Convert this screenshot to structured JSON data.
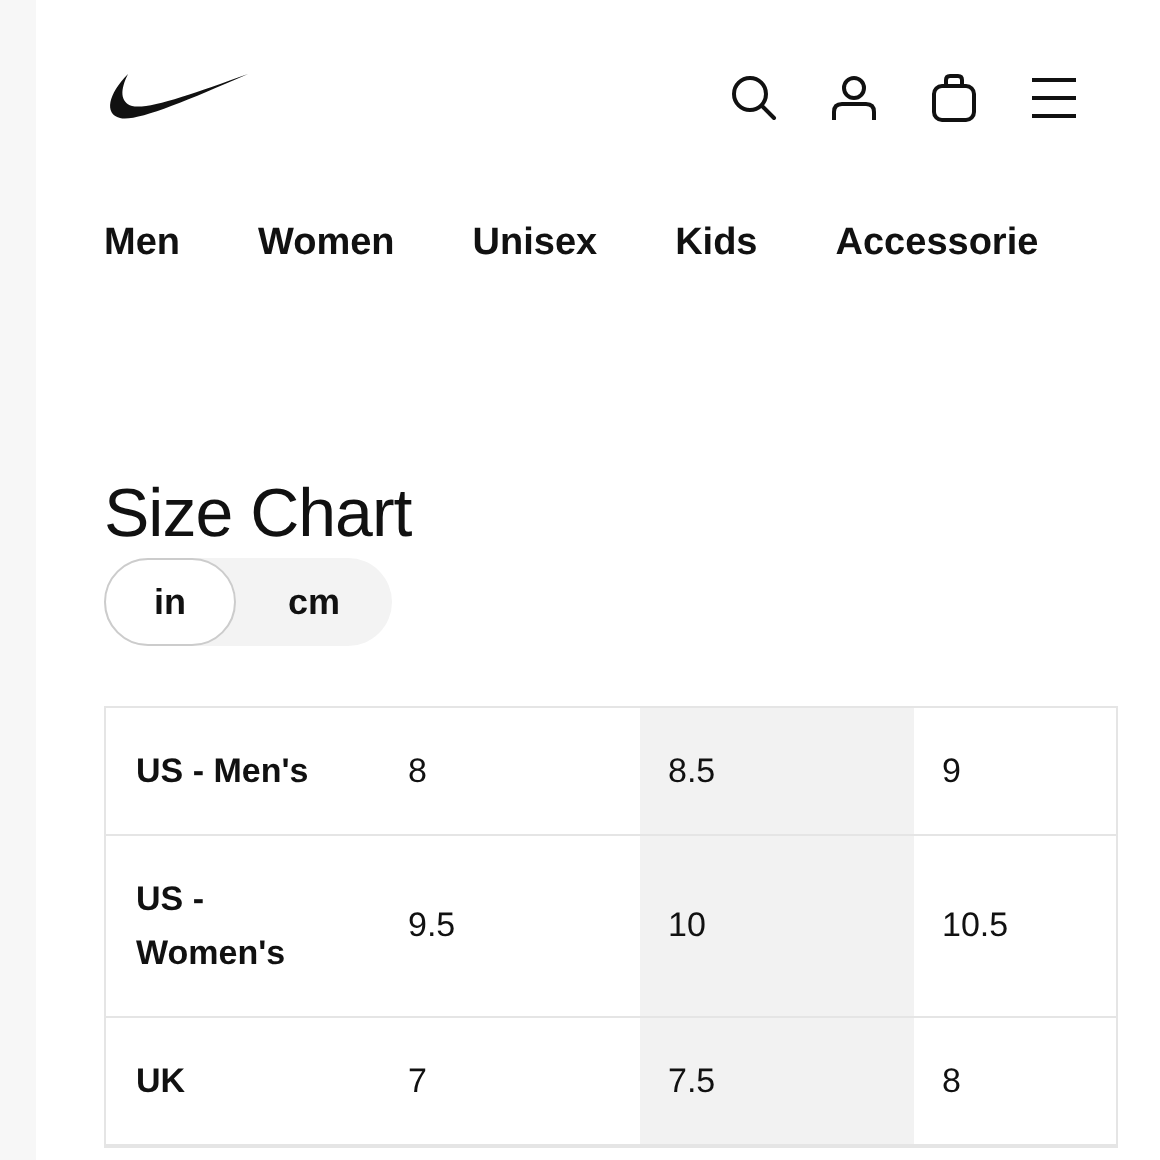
{
  "nav": [
    {
      "label": "Men"
    },
    {
      "label": "Women"
    },
    {
      "label": "Unisex"
    },
    {
      "label": "Kids"
    },
    {
      "label": "Accessorie"
    }
  ],
  "title": "Size Chart",
  "units": [
    {
      "label": "in",
      "selected": true
    },
    {
      "label": "cm",
      "selected": false
    }
  ],
  "table": {
    "rows": [
      {
        "label": "US - Men's",
        "cells": [
          {
            "text": "8",
            "shaded": false
          },
          {
            "text": "8.5",
            "shaded": true
          },
          {
            "text": "9",
            "shaded": false
          }
        ]
      },
      {
        "label": "US - Women's",
        "cells": [
          {
            "text": "9.5",
            "shaded": false
          },
          {
            "text": "10",
            "shaded": true
          },
          {
            "text": "10.5",
            "shaded": false
          }
        ]
      },
      {
        "label": "UK",
        "cells": [
          {
            "text": "7",
            "shaded": false
          },
          {
            "text": "7.5",
            "shaded": true
          },
          {
            "text": "8",
            "shaded": false
          }
        ]
      }
    ]
  }
}
